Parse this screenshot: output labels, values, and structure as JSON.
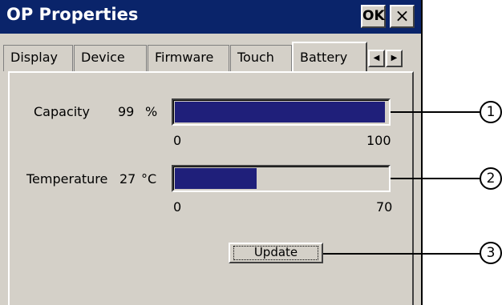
{
  "window": {
    "title": "OP Properties",
    "ok_label": "OK",
    "close_label": "×"
  },
  "tabs": [
    {
      "label": "Display"
    },
    {
      "label": "Device"
    },
    {
      "label": "Firmware"
    },
    {
      "label": "Touch"
    },
    {
      "label": "Battery"
    }
  ],
  "tab_scroll": {
    "left": "◀",
    "right": "▶"
  },
  "capacity": {
    "label": "Capacity",
    "value": "99",
    "unit": "%",
    "min": "0",
    "max": "100",
    "level": 0.99
  },
  "temperature": {
    "label": "Temperature",
    "value": "27",
    "unit": "°C",
    "min": "0",
    "max": "70",
    "level": 0.386
  },
  "update_label": "Update",
  "callouts": [
    "1",
    "2",
    "3"
  ],
  "colors": {
    "titlebar": "#0a246a",
    "bar_fill": "#1f1f7a",
    "face": "#d4d0c8"
  }
}
